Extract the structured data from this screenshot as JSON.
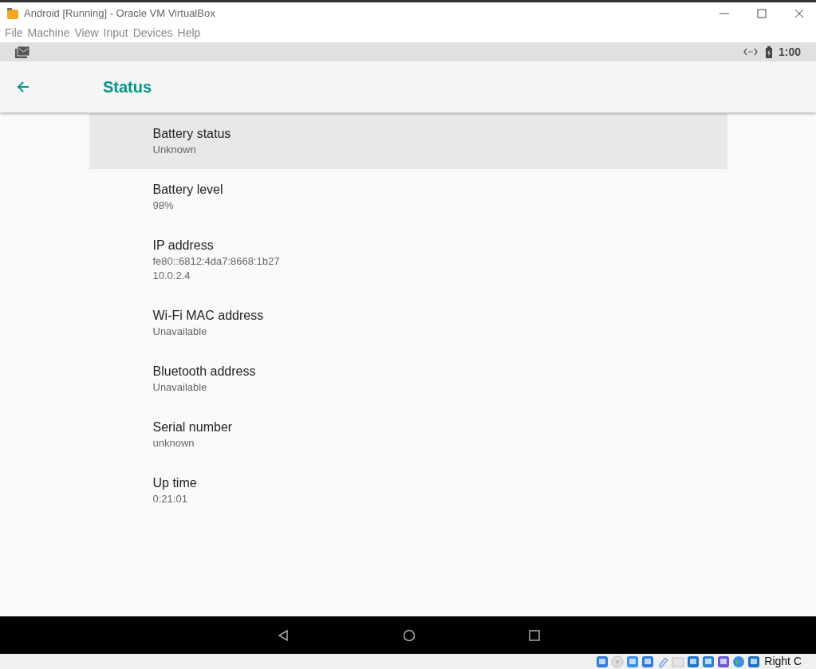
{
  "window": {
    "title": "Android [Running] - Oracle VM VirtualBox"
  },
  "menu": [
    "File",
    "Machine",
    "View",
    "Input",
    "Devices",
    "Help"
  ],
  "android_status_bar": {
    "time": "1:00"
  },
  "app_bar": {
    "title": "Status"
  },
  "items": [
    {
      "title": "Battery status",
      "values": [
        "Unknown"
      ],
      "selected": true
    },
    {
      "title": "Battery level",
      "values": [
        "98%"
      ],
      "selected": false
    },
    {
      "title": "IP address",
      "values": [
        "fe80::6812:4da7:8668:1b27",
        "10.0.2.4"
      ],
      "selected": false
    },
    {
      "title": "Wi-Fi MAC address",
      "values": [
        "Unavailable"
      ],
      "selected": false
    },
    {
      "title": "Bluetooth address",
      "values": [
        "Unavailable"
      ],
      "selected": false
    },
    {
      "title": "Serial number",
      "values": [
        "unknown"
      ],
      "selected": false
    },
    {
      "title": "Up time",
      "values": [
        "0:21:01"
      ],
      "selected": false
    }
  ],
  "status_bar": {
    "host_key": "Right C"
  }
}
